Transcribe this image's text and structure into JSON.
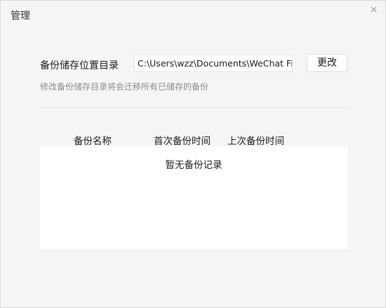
{
  "window": {
    "title": "管理"
  },
  "storage": {
    "label": "备份储存位置目录",
    "path_value": "C:\\Users\\wzz\\Documents\\WeChat Files",
    "change_button": "更改",
    "hint": "修改备份储存目录将会迁移所有已储存的备份"
  },
  "table": {
    "columns": [
      "备份名称",
      "首次备份时间",
      "上次备份时间"
    ],
    "rows": [],
    "empty_text": "暂无备份记录"
  },
  "icons": {
    "close": "close-icon"
  },
  "colors": {
    "background": "#f5f5f5",
    "list_background": "#ffffff",
    "hint_text": "#8c8c8c"
  }
}
